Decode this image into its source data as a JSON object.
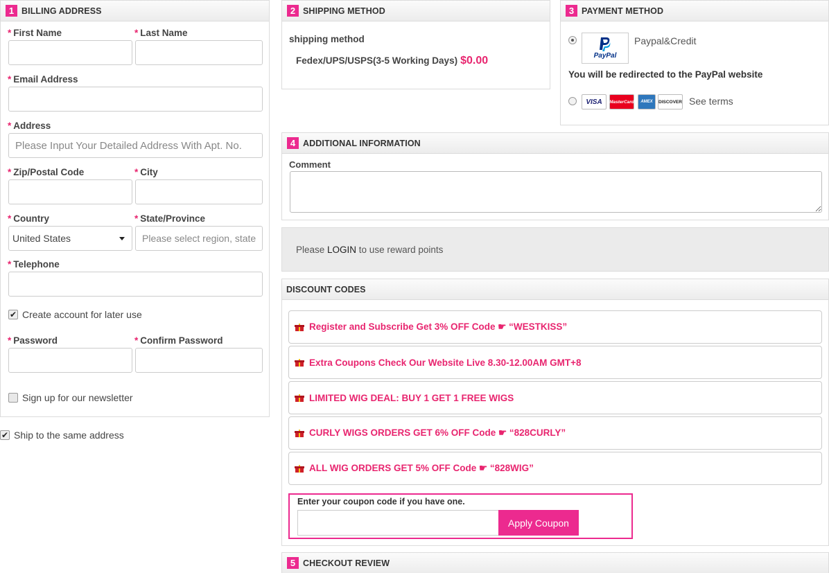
{
  "billing": {
    "num": "1",
    "title": "BILLING ADDRESS",
    "first_name": "First Name",
    "last_name": "Last Name",
    "email": "Email Address",
    "address": "Address",
    "address_placeholder": "Please Input Your Detailed Address With Apt. No.",
    "zip": "Zip/Postal Code",
    "city": "City",
    "country": "Country",
    "country_value": "United States",
    "state": "State/Province",
    "state_placeholder": "Please select region, state",
    "telephone": "Telephone",
    "create_account": "Create account for later use",
    "password": "Password",
    "confirm_password": "Confirm Password",
    "newsletter": "Sign up for our newsletter",
    "req_mark": "*"
  },
  "ship_same": "Ship to the same address",
  "shipping": {
    "num": "2",
    "title": "SHIPPING METHOD",
    "subtitle": "shipping method",
    "option": "Fedex/UPS/USPS(3-5 Working Days)",
    "price": "$0.00"
  },
  "payment": {
    "num": "3",
    "title": "PAYMENT METHOD",
    "paypal_label": "Paypal&Credit",
    "paypal_logo_text": "PayPal",
    "redirect_note": "You will be redirected to the PayPal website",
    "see_terms": "See terms",
    "cards": [
      "VISA",
      "MasterCard",
      "AMEX",
      "DISCOVER"
    ]
  },
  "additional": {
    "num": "4",
    "title": "ADDITIONAL INFORMATION",
    "comment_label": "Comment"
  },
  "reward": {
    "prefix": "Please ",
    "login": "LOGIN",
    "suffix": " to use reward points"
  },
  "discount": {
    "title": "DISCOUNT CODES",
    "codes": [
      "Register and Subscribe Get 3% OFF Code ☛ “WESTKISS”",
      "Extra Coupons Check Our Website Live 8.30-12.00AM GMT+8",
      "LIMITED WIG DEAL: BUY 1 GET 1 FREE WIGS",
      "CURLY WIGS ORDERS GET 6% OFF Code ☛ “828CURLY”",
      "ALL WIG ORDERS GET 5% OFF Code ☛ “828WIG”"
    ],
    "coupon_prompt": "Enter your coupon code if you have one.",
    "apply_label": "Apply Coupon"
  },
  "review": {
    "num": "5",
    "title": "CHECKOUT REVIEW"
  },
  "colors": {
    "accent": "#ec2a8f",
    "coupon_text": "#e8256f",
    "paypal_blue": "#003087"
  }
}
